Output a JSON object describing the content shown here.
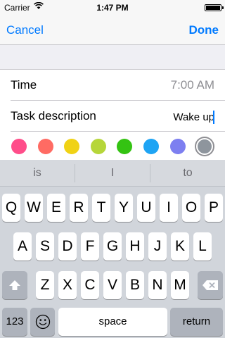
{
  "status_bar": {
    "carrier": "Carrier",
    "time": "1:47 PM",
    "battery_level": 1.0
  },
  "navbar": {
    "cancel_label": "Cancel",
    "done_label": "Done"
  },
  "form": {
    "time_label": "Time",
    "time_value": "7:00 AM",
    "task_label": "Task description",
    "task_value": "Wake up"
  },
  "color_options": [
    "#ff4d8a",
    "#ff6b63",
    "#f0d215",
    "#b6d63a",
    "#34c312",
    "#1ea4f4",
    "#7d7ff0",
    "#8e959d"
  ],
  "selected_color": "#8e959d",
  "keyboard": {
    "predictions": [
      "is",
      "I",
      "to"
    ],
    "row1": [
      "Q",
      "W",
      "E",
      "R",
      "T",
      "Y",
      "U",
      "I",
      "O",
      "P"
    ],
    "row2": [
      "A",
      "S",
      "D",
      "F",
      "G",
      "H",
      "J",
      "K",
      "L"
    ],
    "row3": [
      "Z",
      "X",
      "C",
      "V",
      "B",
      "N",
      "M"
    ],
    "numbers_label": "123",
    "space_label": "space",
    "return_label": "return",
    "shift_icon": "shift-icon",
    "delete_icon": "delete-icon",
    "emoji_icon": "emoji-icon"
  }
}
